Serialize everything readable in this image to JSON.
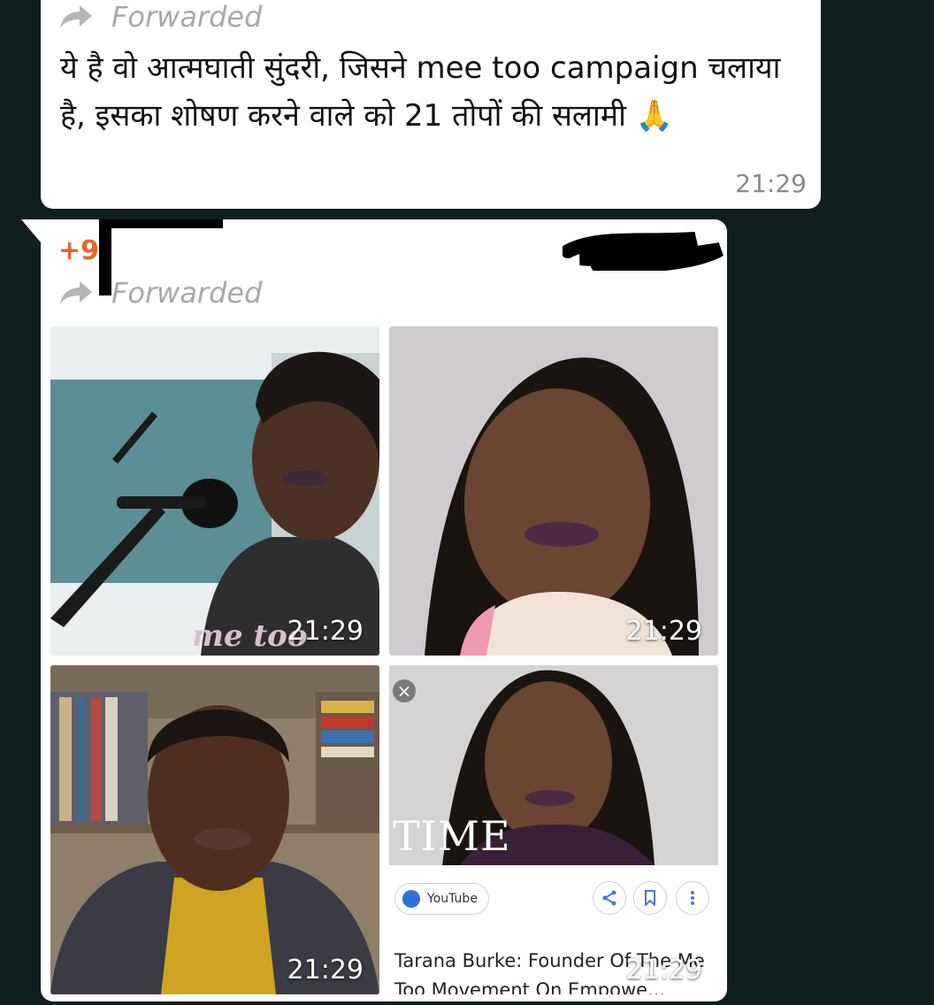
{
  "messages": [
    {
      "forwarded_label": "Forwarded",
      "text": "ये है वो आत्मघाती सुंदरी, जिसने mee too campaign चलाया है, इसका शोषण करने वाले को 21 तोपों की सलामी 🙏",
      "time": "21:29"
    },
    {
      "sender": "+9",
      "forwarded_label": "Forwarded",
      "tiles": [
        {
          "time": "21:29",
          "shirt_text": "me too"
        },
        {
          "time": "21:29"
        },
        {
          "time": "21:29"
        },
        {
          "time": "21:29",
          "close_glyph": "×",
          "banner_text": "TIME",
          "source_label": "YouTube",
          "caption": "Tarana Burke: Founder Of The Me Too Movement On Empowe..."
        }
      ]
    }
  ],
  "colors": {
    "background": "#0f1f1f",
    "bubble": "#ffffff",
    "sender": "#e8642c",
    "meta_text": "#8a8a8a"
  },
  "icons": [
    "forward-arrow-icon",
    "close-icon",
    "globe-icon",
    "share-icon",
    "bookmark-icon",
    "more-vert-icon"
  ]
}
